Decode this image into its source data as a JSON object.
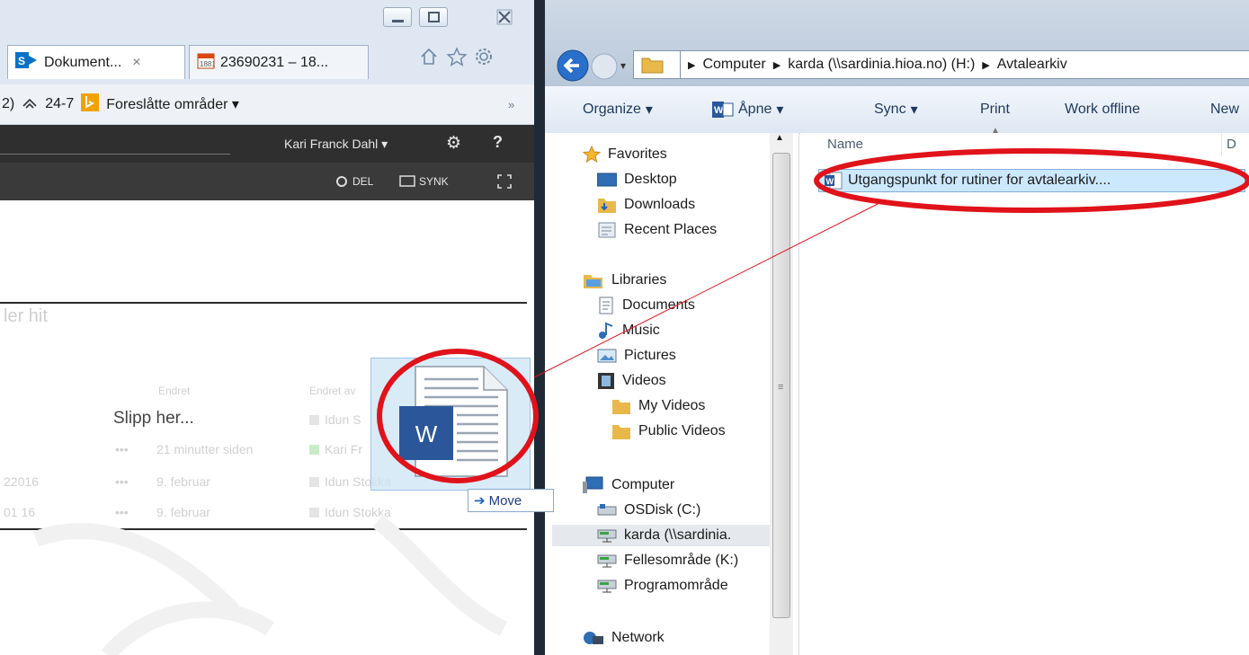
{
  "ie": {
    "tabs": [
      {
        "label": "Dokument...",
        "close": "×",
        "icon": "sharepoint-icon"
      },
      {
        "label": "23690231 – 18...",
        "icon": "calendar-icon"
      }
    ],
    "favorites_bar": {
      "partial_prefix": "2)",
      "item_24_7": "24-7",
      "suggested_sites": "Foreslåtte områder",
      "chevron": "»"
    },
    "sharepoint": {
      "user_name": "Kari Franck Dahl",
      "settings_symbol": "⚙",
      "help_symbol": "?",
      "share_label": "DEL",
      "sync_label": "SYNK"
    },
    "library": {
      "drop_hint_partial": "ler hit",
      "col_modified": "Endret",
      "col_modified_by": "Endret av",
      "drop_label": "Slipp her...",
      "rows": [
        {
          "name_partial": "",
          "dots": "",
          "modified": "",
          "modified_by": "Idun S"
        },
        {
          "name_partial": "",
          "dots": "•••",
          "modified": "21 minutter siden",
          "modified_by": "Kari Fr"
        },
        {
          "name_partial": "22016",
          "dots": "•••",
          "modified": "9. februar",
          "modified_by": "Idun Stokka"
        },
        {
          "name_partial": "01 16",
          "dots": "•••",
          "modified": "9. februar",
          "modified_by": "Idun Stokka"
        }
      ]
    }
  },
  "explorer": {
    "breadcrumb": [
      "Computer",
      "karda (\\\\sardinia.hioa.no) (H:)",
      "Avtalearkiv"
    ],
    "toolbar": {
      "organize": "Organize",
      "open": "Åpne",
      "sync": "Sync",
      "print": "Print",
      "work_offline": "Work offline",
      "new_partial": "New"
    },
    "nav": {
      "favorites": "Favorites",
      "desktop": "Desktop",
      "downloads": "Downloads",
      "recent_places": "Recent Places",
      "libraries": "Libraries",
      "documents": "Documents",
      "music": "Music",
      "pictures": "Pictures",
      "videos": "Videos",
      "my_videos": "My Videos",
      "public_videos": "Public Videos",
      "computer": "Computer",
      "osdisk": "OSDisk (C:)",
      "karda": "karda (\\\\sardinia.",
      "fellesomrade": "Fellesområde (K:)",
      "programomrade": "Programområde",
      "network": "Network"
    },
    "content": {
      "col_name": "Name",
      "col_date_partial": "D",
      "file_name": "Utgangspunkt for rutiner for avtalearkiv...."
    }
  },
  "drag": {
    "move_label": "Move",
    "word_letter": "W"
  },
  "colors": {
    "annotation_red": "#e0121a",
    "word_blue": "#2b579a",
    "sharepoint_bar": "#2f2f2f",
    "selection_blue": "#cce8ff"
  }
}
